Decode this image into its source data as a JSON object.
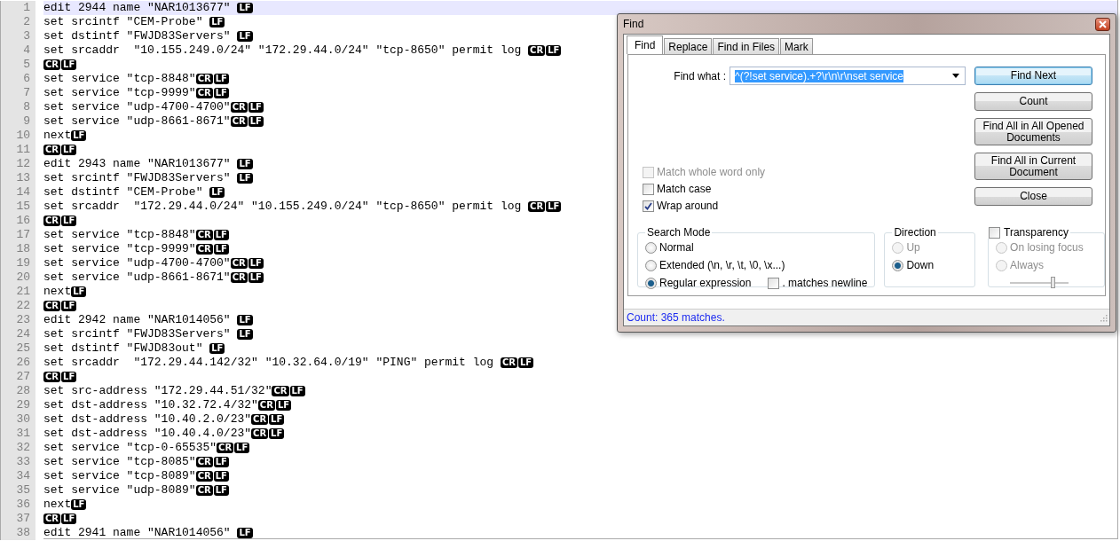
{
  "editor": {
    "lines": [
      {
        "number": "1",
        "text": "edit 2944 name \"NAR1013677\" ",
        "eol": [
          "LF"
        ],
        "current": true
      },
      {
        "number": "2",
        "text": "set srcintf \"CEM-Probe\" ",
        "eol": [
          "LF"
        ],
        "current": false
      },
      {
        "number": "3",
        "text": "set dstintf \"FWJD83Servers\" ",
        "eol": [
          "LF"
        ],
        "current": false
      },
      {
        "number": "4",
        "text": "set srcaddr  \"10.155.249.0/24\" \"172.29.44.0/24\" \"tcp-8650\" permit log ",
        "eol": [
          "CR",
          "LF"
        ],
        "current": false
      },
      {
        "number": "5",
        "eol": [
          "CR",
          "LF"
        ],
        "current": false
      },
      {
        "number": "6",
        "text": "set service \"tcp-8848\"",
        "eol": [
          "CR",
          "LF"
        ],
        "current": false
      },
      {
        "number": "7",
        "text": "set service \"tcp-9999\"",
        "eol": [
          "CR",
          "LF"
        ],
        "current": false
      },
      {
        "number": "8",
        "text": "set service \"udp-4700-4700\"",
        "eol": [
          "CR",
          "LF"
        ],
        "current": false
      },
      {
        "number": "9",
        "text": "set service \"udp-8661-8671\"",
        "eol": [
          "CR",
          "LF"
        ],
        "current": false
      },
      {
        "number": "10",
        "text": "next",
        "eol": [
          "LF"
        ],
        "current": false
      },
      {
        "number": "11",
        "eol": [
          "CR",
          "LF"
        ],
        "current": false
      },
      {
        "number": "12",
        "text": "edit 2943 name \"NAR1013677\" ",
        "eol": [
          "LF"
        ],
        "current": false
      },
      {
        "number": "13",
        "text": "set srcintf \"FWJD83Servers\" ",
        "eol": [
          "LF"
        ],
        "current": false
      },
      {
        "number": "14",
        "text": "set dstintf \"CEM-Probe\" ",
        "eol": [
          "LF"
        ],
        "current": false
      },
      {
        "number": "15",
        "text": "set srcaddr  \"172.29.44.0/24\" \"10.155.249.0/24\" \"tcp-8650\" permit log ",
        "eol": [
          "CR",
          "LF"
        ],
        "current": false
      },
      {
        "number": "16",
        "eol": [
          "CR",
          "LF"
        ],
        "current": false
      },
      {
        "number": "17",
        "text": "set service \"tcp-8848\"",
        "eol": [
          "CR",
          "LF"
        ],
        "current": false
      },
      {
        "number": "18",
        "text": "set service \"tcp-9999\"",
        "eol": [
          "CR",
          "LF"
        ],
        "current": false
      },
      {
        "number": "19",
        "text": "set service \"udp-4700-4700\"",
        "eol": [
          "CR",
          "LF"
        ],
        "current": false
      },
      {
        "number": "20",
        "text": "set service \"udp-8661-8671\"",
        "eol": [
          "CR",
          "LF"
        ],
        "current": false
      },
      {
        "number": "21",
        "text": "next",
        "eol": [
          "LF"
        ],
        "current": false
      },
      {
        "number": "22",
        "eol": [
          "CR",
          "LF"
        ],
        "current": false
      },
      {
        "number": "23",
        "text": "edit 2942 name \"NAR1014056\" ",
        "eol": [
          "LF"
        ],
        "current": false
      },
      {
        "number": "24",
        "text": "set srcintf \"FWJD83Servers\" ",
        "eol": [
          "LF"
        ],
        "current": false
      },
      {
        "number": "25",
        "text": "set dstintf \"FWJD83out\" ",
        "eol": [
          "LF"
        ],
        "current": false
      },
      {
        "number": "26",
        "text": "set srcaddr  \"172.29.44.142/32\" \"10.32.64.0/19\" \"PING\" permit log ",
        "eol": [
          "CR",
          "LF"
        ],
        "current": false
      },
      {
        "number": "27",
        "eol": [
          "CR",
          "LF"
        ],
        "current": false
      },
      {
        "number": "28",
        "text": "set src-address \"172.29.44.51/32\"",
        "eol": [
          "CR",
          "LF"
        ],
        "current": false
      },
      {
        "number": "29",
        "text": "set dst-address \"10.32.72.4/32\"",
        "eol": [
          "CR",
          "LF"
        ],
        "current": false
      },
      {
        "number": "30",
        "text": "set dst-address \"10.40.2.0/23\"",
        "eol": [
          "CR",
          "LF"
        ],
        "current": false
      },
      {
        "number": "31",
        "text": "set dst-address \"10.40.4.0/23\"",
        "eol": [
          "CR",
          "LF"
        ],
        "current": false
      },
      {
        "number": "32",
        "text": "set service \"tcp-0-65535\"",
        "eol": [
          "CR",
          "LF"
        ],
        "current": false
      },
      {
        "number": "33",
        "text": "set service \"tcp-8085\"",
        "eol": [
          "CR",
          "LF"
        ],
        "current": false
      },
      {
        "number": "34",
        "text": "set service \"tcp-8089\"",
        "eol": [
          "CR",
          "LF"
        ],
        "current": false
      },
      {
        "number": "35",
        "text": "set service \"udp-8089\"",
        "eol": [
          "CR",
          "LF"
        ],
        "current": false
      },
      {
        "number": "36",
        "text": "next",
        "eol": [
          "LF"
        ],
        "current": false
      },
      {
        "number": "37",
        "eol": [
          "CR",
          "LF"
        ],
        "current": false
      },
      {
        "number": "38",
        "text": "edit 2941 name \"NAR1014056\" ",
        "eol": [
          "LF"
        ],
        "current": false
      }
    ]
  },
  "find_dialog": {
    "title": "Find",
    "tabs": [
      {
        "label": "Find",
        "selected": true
      },
      {
        "label": "Replace",
        "selected": false
      },
      {
        "label": "Find in Files",
        "selected": false
      },
      {
        "label": "Mark",
        "selected": false
      }
    ],
    "find_what": {
      "label": "Find what :",
      "value": "^(?!set service).+?\\r\\n\\r\\nset service",
      "text_selected": true
    },
    "buttons": [
      {
        "label": "Find Next",
        "default": true
      },
      {
        "label": "Count",
        "default": false
      },
      {
        "label": "Find All in All Opened Documents",
        "default": false
      },
      {
        "label": "Find All in Current Document",
        "default": false
      },
      {
        "label": "Close",
        "default": false
      }
    ],
    "options": [
      {
        "label": "Match whole word only",
        "checked": false,
        "disabled": true
      },
      {
        "label": "Match case",
        "checked": false,
        "disabled": false
      },
      {
        "label": "Wrap around",
        "checked": true,
        "disabled": false
      }
    ],
    "search_mode": {
      "title": "Search Mode",
      "options": [
        {
          "label": "Normal",
          "selected": false
        },
        {
          "label": "Extended (\\n, \\r, \\t, \\0, \\x...)",
          "selected": false
        },
        {
          "label": "Regular expression",
          "selected": true
        }
      ],
      "dot_matches_newline": {
        "label": ". matches newline",
        "checked": false
      }
    },
    "direction": {
      "title": "Direction",
      "options": [
        {
          "label": "Up",
          "selected": false,
          "disabled": true
        },
        {
          "label": "Down",
          "selected": true,
          "disabled": false
        }
      ]
    },
    "transparency": {
      "label": "Transparency",
      "checked": false,
      "options": [
        {
          "label": "On losing focus",
          "selected": false
        },
        {
          "label": "Always",
          "selected": false
        }
      ],
      "slider": {
        "level": 0.72
      }
    },
    "status": "Count: 365 matches."
  }
}
